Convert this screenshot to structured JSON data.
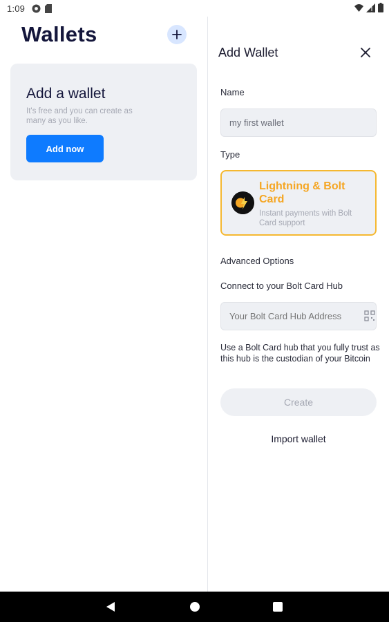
{
  "status_bar": {
    "time": "1:09",
    "icons_left": [
      "chrome-icon",
      "sd-card-icon"
    ],
    "icons_right": [
      "wifi-icon",
      "signal-icon",
      "battery-icon"
    ]
  },
  "wallets_pane": {
    "title": "Wallets",
    "add_icon": "plus-icon",
    "card": {
      "title": "Add a wallet",
      "description": "It's free and you can create as many as you like.",
      "button_label": "Add now"
    }
  },
  "add_wallet_panel": {
    "title": "Add Wallet",
    "close_icon": "close-icon",
    "name_label": "Name",
    "name_value": "my first wallet",
    "type_label": "Type",
    "type_option": {
      "title": "Lightning & Bolt Card",
      "description": "Instant payments with Bolt Card support",
      "icon": "lightning-bolt-card-icon"
    },
    "advanced_label": "Advanced Options",
    "hub_label": "Connect to your Bolt Card Hub",
    "hub_placeholder": "Your Bolt Card Hub Address",
    "qr_icon": "qr-code-icon",
    "hub_note": "Use a Bolt Card hub that you fully trust as this hub is the custodian of your Bitcoin",
    "create_label": "Create",
    "import_label": "Import wallet"
  },
  "nav_bar": {
    "icons": [
      "back-icon",
      "home-icon",
      "recents-icon"
    ]
  },
  "colors": {
    "accent": "#0e7bff",
    "lightning": "#f5a623",
    "card_bg": "#eef0f4",
    "title": "#14163b"
  }
}
